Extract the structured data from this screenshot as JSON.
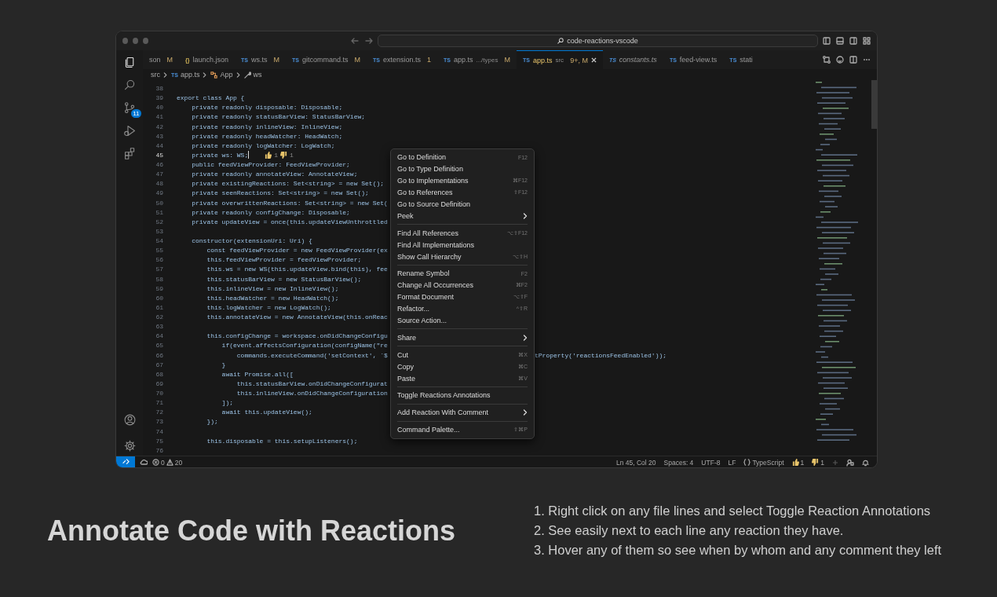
{
  "window": {
    "search": "code-reactions-vscode"
  },
  "activity_bar": {
    "items": [
      {
        "kind": "explorer",
        "selected": true
      },
      {
        "kind": "search",
        "selected": false
      },
      {
        "kind": "source-control",
        "selected": false,
        "badge": "11"
      },
      {
        "kind": "run",
        "selected": false
      },
      {
        "kind": "extensions",
        "selected": false
      }
    ],
    "bottom": [
      {
        "kind": "account"
      },
      {
        "kind": "settings"
      }
    ]
  },
  "tabs": [
    {
      "label": "son",
      "note": "M",
      "selected": false,
      "italic": false
    },
    {
      "icon": "{}",
      "label": "launch.json",
      "selected": false,
      "italic": false
    },
    {
      "icon": "TS",
      "label": "ws.ts",
      "note": "M",
      "selected": false,
      "italic": false
    },
    {
      "icon": "TS",
      "label": "gitcommand.ts",
      "note": "M",
      "selected": false,
      "italic": false
    },
    {
      "icon": "TS",
      "label": "extension.ts",
      "note": "1",
      "selected": false,
      "italic": false
    },
    {
      "icon": "TS",
      "label": "app.ts",
      "description": ".../types",
      "note": "M",
      "selected": false,
      "italic": false
    },
    {
      "icon": "TS",
      "label": "app.ts",
      "description": "src",
      "note": "9+, M",
      "selected": true,
      "italic": false
    },
    {
      "icon": "TS",
      "label": "constants.ts",
      "selected": false,
      "italic": true
    },
    {
      "icon": "TS",
      "label": "feed-view.ts",
      "selected": false,
      "italic": false
    },
    {
      "icon": "TS",
      "label": "stati",
      "selected": false,
      "italic": false
    }
  ],
  "breadcrumbs": [
    {
      "kind": "folder",
      "label": "src"
    },
    {
      "kind": "file",
      "icon": "TS",
      "label": "app.ts"
    },
    {
      "kind": "class",
      "label": "App"
    },
    {
      "kind": "field",
      "label": "ws"
    }
  ],
  "editor": {
    "lines": [
      {
        "number": "38",
        "current": false
      },
      {
        "number": "39",
        "code": "export class App {",
        "current": false
      },
      {
        "number": "40",
        "code": "    private readonly disposable: Disposable;",
        "current": false
      },
      {
        "number": "41",
        "code": "    private readonly statusBarView: StatusBarView;",
        "current": false
      },
      {
        "number": "42",
        "code": "    private readonly inlineView: InlineView;",
        "current": false
      },
      {
        "number": "43",
        "code": "    private readonly headWatcher: HeadWatch;",
        "current": false
      },
      {
        "number": "44",
        "code": "    private readonly logWatcher: LogWatch;",
        "current": false
      },
      {
        "number": "45",
        "code": "    private ws: WS;",
        "current": true,
        "reactions": {
          "up": "1",
          "down": "1"
        }
      },
      {
        "number": "46",
        "code": "    public feedViewProvider: FeedViewProvider;",
        "current": false
      },
      {
        "number": "47",
        "code": "    private readonly annotateView: AnnotateView;",
        "current": false
      },
      {
        "number": "48",
        "code": "    private existingReactions: Set<string> = new Set();",
        "current": false
      },
      {
        "number": "49",
        "code": "    private seenReactions: Set<string> = new Set();",
        "current": false
      },
      {
        "number": "50",
        "code": "    private overwrittenReactions: Set<string> = new Set(",
        "current": false
      },
      {
        "number": "51",
        "code": "    private readonly configChange: Disposable;",
        "current": false
      },
      {
        "number": "52",
        "code": "    private updateView = once(this.updateViewUnthrottled",
        "current": false
      },
      {
        "number": "53",
        "current": false
      },
      {
        "number": "54",
        "code": "    constructor(extensionUri: Uri) {",
        "current": false
      },
      {
        "number": "55",
        "code": "        const feedViewProvider = new FeedViewProvider(ex",
        "current": false
      },
      {
        "number": "56",
        "code": "        this.feedViewProvider = feedViewProvider;",
        "current": false
      },
      {
        "number": "57",
        "code": "        this.ws = new WS(this.updateView.bind(this), fee",
        "current": false
      },
      {
        "number": "58",
        "code": "        this.statusBarView = new StatusBarView();",
        "current": false
      },
      {
        "number": "59",
        "code": "        this.inlineView = new InlineView();",
        "current": false
      },
      {
        "number": "60",
        "code": "        this.headWatcher = new HeadWatch();",
        "current": false
      },
      {
        "number": "61",
        "code": "        this.logWatcher = new LogWatch();",
        "current": false
      },
      {
        "number": "62",
        "code": "        this.annotateView = new AnnotateView(this.onReac",
        "current": false
      },
      {
        "number": "63",
        "current": false
      },
      {
        "number": "64",
        "code": "        this.configChange = workspace.onDidChangeConfigu",
        "current": false
      },
      {
        "number": "65",
        "code": "            if(event.affectsConfiguration(configName(\"re",
        "current": false
      },
      {
        "number": "66",
        "code": "                commands.executeCommand('setContext', `$",
        "tail": "tProperty('reactionsFeedEnabled'));",
        "current": false
      },
      {
        "number": "67",
        "code": "            }",
        "current": false
      },
      {
        "number": "68",
        "code": "            await Promise.all([",
        "current": false
      },
      {
        "number": "69",
        "code": "                this.statusBarView.onDidChangeConfigurat",
        "current": false
      },
      {
        "number": "70",
        "code": "                this.inlineView.onDidChangeConfiguration",
        "current": false
      },
      {
        "number": "71",
        "code": "            ]);",
        "current": false
      },
      {
        "number": "72",
        "code": "            await this.updateView();",
        "current": false
      },
      {
        "number": "73",
        "code": "        });",
        "current": false
      },
      {
        "number": "74",
        "current": false
      },
      {
        "number": "75",
        "code": "        this.disposable = this.setupListeners();",
        "current": false
      },
      {
        "number": "76",
        "current": false
      }
    ]
  },
  "context_menu": {
    "groups": [
      [
        {
          "label": "Go to Definition",
          "shortcut": "F12",
          "submenu": false
        },
        {
          "label": "Go to Type Definition",
          "submenu": false
        },
        {
          "label": "Go to Implementations",
          "shortcut": "⌘F12",
          "submenu": false
        },
        {
          "label": "Go to References",
          "shortcut": "⇧F12",
          "submenu": false
        },
        {
          "label": "Go to Source Definition",
          "submenu": false
        },
        {
          "label": "Peek",
          "submenu": true
        }
      ],
      [
        {
          "label": "Find All References",
          "shortcut": "⌥⇧F12",
          "submenu": false
        },
        {
          "label": "Find All Implementations",
          "submenu": false
        },
        {
          "label": "Show Call Hierarchy",
          "shortcut": "⌥⇧H",
          "submenu": false
        }
      ],
      [
        {
          "label": "Rename Symbol",
          "shortcut": "F2",
          "submenu": false
        },
        {
          "label": "Change All Occurrences",
          "shortcut": "⌘F2",
          "submenu": false
        },
        {
          "label": "Format Document",
          "shortcut": "⌥⇧F",
          "submenu": false
        },
        {
          "label": "Refactor...",
          "shortcut": "^⇧R",
          "submenu": false
        },
        {
          "label": "Source Action...",
          "submenu": false
        }
      ],
      [
        {
          "label": "Share",
          "submenu": true
        }
      ],
      [
        {
          "label": "Cut",
          "shortcut": "⌘X",
          "submenu": false
        },
        {
          "label": "Copy",
          "shortcut": "⌘C",
          "submenu": false
        },
        {
          "label": "Paste",
          "shortcut": "⌘V",
          "submenu": false
        }
      ],
      [
        {
          "label": "Toggle Reactions Annotations",
          "submenu": false
        }
      ],
      [
        {
          "label": "Add Reaction With Comment",
          "submenu": true
        }
      ],
      [
        {
          "label": "Command Palette...",
          "shortcut": "⇧⌘P",
          "submenu": false
        }
      ]
    ]
  },
  "status_bar": {
    "errors": "0",
    "warnings": "20",
    "position": "Ln 45, Col 20",
    "spaces": "Spaces: 4",
    "encoding": "UTF-8",
    "eol": "LF",
    "language": "TypeScript",
    "thumbs_up": "1",
    "thumbs_down": "1"
  },
  "caption": {
    "title": "Annotate Code with Reactions",
    "steps": [
      "1. Right click on any file lines and select Toggle Reaction Annotations",
      "2. See easily next to each line any reaction they have.",
      "3. Hover any of them so see when by whom and any comment they left"
    ]
  }
}
